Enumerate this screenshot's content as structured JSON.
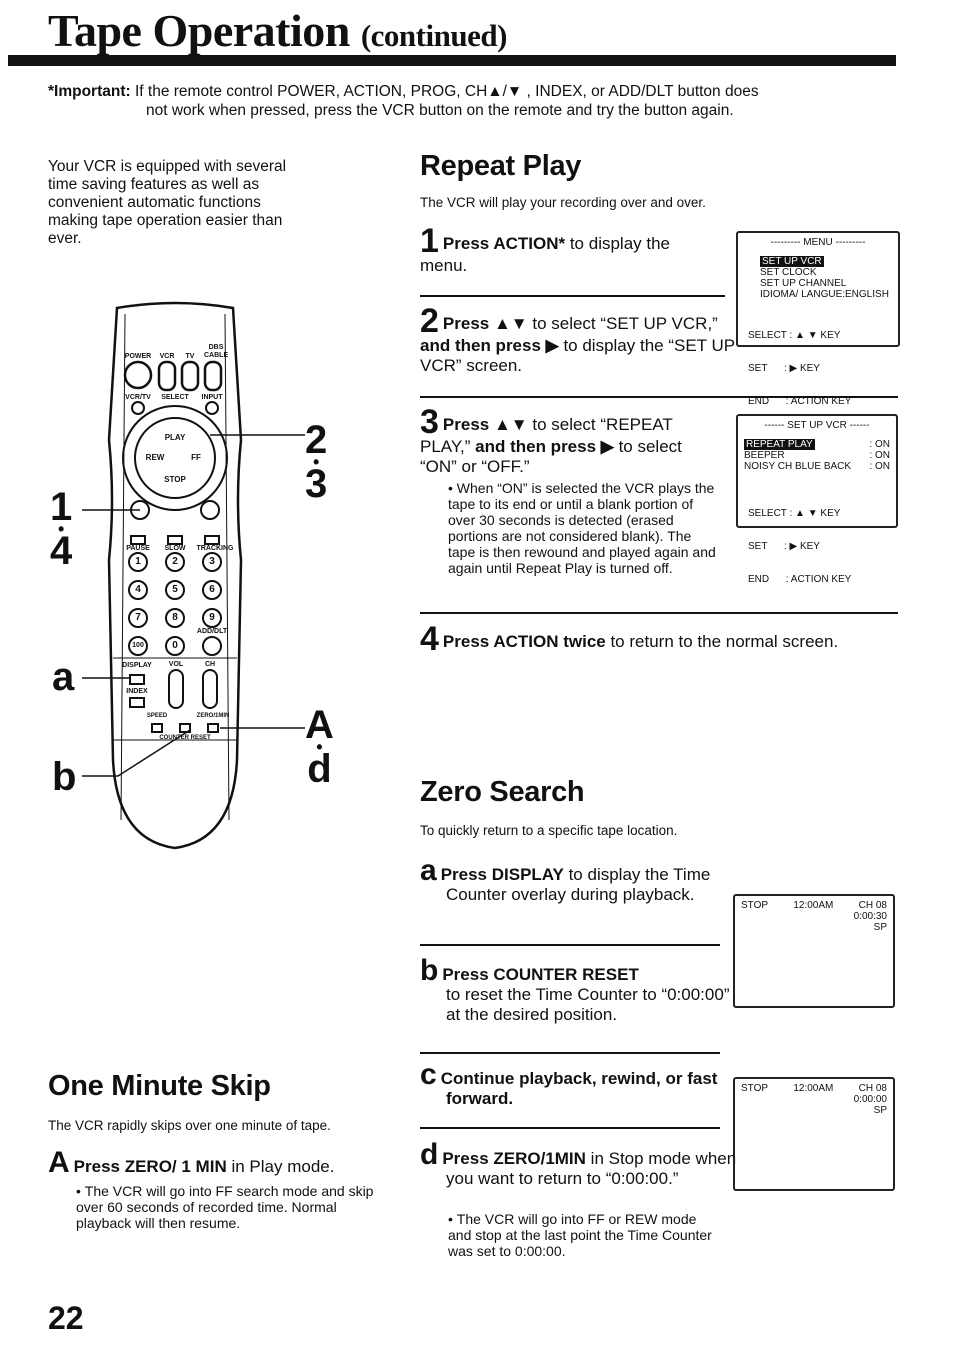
{
  "header": {
    "title": "Tape Operation",
    "title_suffix": "(continued)"
  },
  "important": {
    "label": "*Important:",
    "line1": "If the remote control POWER, ACTION, PROG, CH▲/▼ , INDEX, or ADD/DLT button does",
    "line2": "not work when pressed, press the VCR button on the remote and try the button again."
  },
  "intro": "Your VCR is equipped with several time saving features as well as convenient automatic functions making tape operation easier than ever.",
  "remote": {
    "labels": [
      "POWER",
      "VCR",
      "TV",
      "DBS CABLE",
      "VCR/TV",
      "SELECT",
      "INPUT",
      "PLAY",
      "REW",
      "FF",
      "STOP",
      "PAUSE",
      "SLOW",
      "TRACKING",
      "1",
      "2",
      "3",
      "4",
      "5",
      "6",
      "7",
      "8",
      "9",
      "100",
      "0",
      "ADD/DLT",
      "DISPLAY",
      "VOL",
      "CH",
      "INDEX",
      "SPEED",
      "COUNTER RESET",
      "ZERO/1MIN"
    ],
    "callouts": {
      "c14": "1",
      "c14b": "4",
      "c23": "2",
      "c23b": "3",
      "ca": "a",
      "cAd": "A",
      "cAdb": "d",
      "cb": "b"
    }
  },
  "repeat": {
    "heading": "Repeat Play",
    "desc": "The VCR will play your recording over and over.",
    "steps": [
      {
        "num": "1",
        "bold": "Press ACTION*",
        "text": " to display the menu."
      },
      {
        "num": "2",
        "bold": "Press ▲▼",
        "text": " to select “SET UP VCR,”",
        "bold2": " and then press ▶",
        "text2": " to display the “SET UP VCR” screen."
      },
      {
        "num": "3",
        "bold": "Press ▲▼",
        "text": " to select “REPEAT PLAY,”",
        "bold2": " and then press ▶",
        "text2": " to select “ON” or “OFF.”"
      },
      {
        "num": "4",
        "bold": "Press ACTION twice",
        "text": " to return to the normal screen."
      }
    ],
    "bullet": "When “ON” is selected the VCR plays the tape to its end or until a blank portion of over 30 seconds is detected (erased portions are not considered blank). The tape is then rewound and played again and again until Repeat Play is turned off.",
    "menu1": {
      "title": "--------- MENU ---------",
      "items": [
        "SET UP VCR",
        "SET CLOCK",
        "SET UP CHANNEL",
        "IDIOMA/ LANGUE:ENGLISH"
      ],
      "keys": [
        "SELECT : ▲ ▼ KEY",
        "SET      : ▶ KEY",
        "END      : ACTION KEY"
      ]
    },
    "menu2": {
      "title": "------ SET UP VCR ------",
      "items": [
        {
          "l": "REPEAT PLAY",
          "v": ": ON"
        },
        {
          "l": "BEEPER",
          "v": ": ON"
        },
        {
          "l": "NOISY CH BLUE BACK",
          "v": ": ON"
        }
      ],
      "keys": [
        "SELECT : ▲ ▼ KEY",
        "SET      : ▶ KEY",
        "END      : ACTION KEY"
      ]
    }
  },
  "zero": {
    "heading": "Zero Search",
    "desc": "To quickly return to a specific tape location.",
    "steps": [
      {
        "num": "a",
        "bold": "Press DISPLAY",
        "text": " to display the Time Counter overlay during playback."
      },
      {
        "num": "b",
        "bold": "Press COUNTER RESET",
        "text": "to reset the Time Counter to “0:00:00” at the desired position."
      },
      {
        "num": "c",
        "bold": "Continue playback, rewind, or fast forward.",
        "text": ""
      },
      {
        "num": "d",
        "bold": "Press ZERO/1MIN",
        "text": " in Stop mode when you want to return to “0:00:00.”"
      }
    ],
    "bullet": "The VCR will go into FF or REW mode and stop at the last point the Time Counter was set to 0:00:00.",
    "screen1": {
      "mode": "STOP",
      "time": "12:00AM",
      "ch": "CH 08",
      "counter": "0:00:30",
      "speed": "SP"
    },
    "screen2": {
      "mode": "STOP",
      "time": "12:00AM",
      "ch": "CH 08",
      "counter": "0:00:00",
      "speed": "SP"
    }
  },
  "skip": {
    "heading": "One Minute Skip",
    "desc": "The VCR rapidly skips over one minute of tape.",
    "step": {
      "num": "A",
      "bold": "Press ZERO/ 1 MIN",
      "text": " in Play mode."
    },
    "bullet": "The VCR will go into FF search mode and skip over 60 seconds of recorded time. Normal playback will then resume."
  },
  "page_number": "22"
}
